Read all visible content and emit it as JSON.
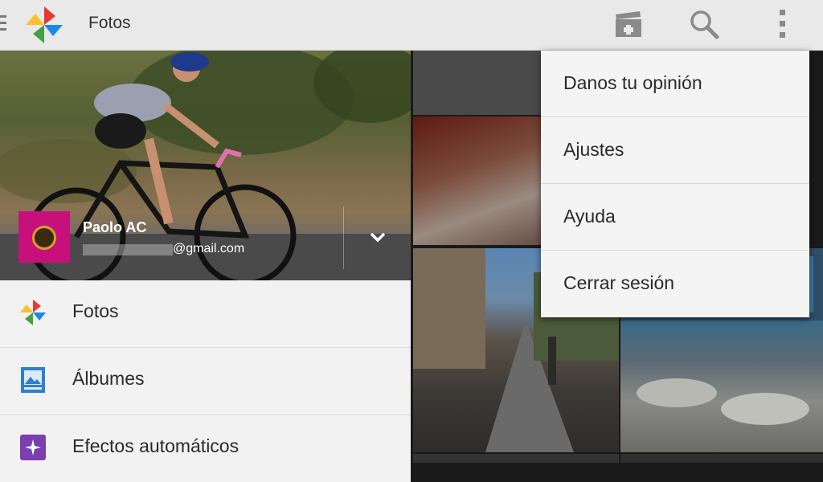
{
  "app": {
    "title": "Fotos"
  },
  "toolbar": {
    "icons": [
      "menu-icon",
      "photos-logo-icon",
      "create-movie-icon",
      "search-icon",
      "more-options-icon"
    ]
  },
  "account": {
    "name": "Paolo AC",
    "email_visible": "@gmail.com"
  },
  "nav": {
    "items": [
      {
        "label": "Fotos",
        "icon": "pinwheel-icon"
      },
      {
        "label": "Álbumes",
        "icon": "album-icon"
      },
      {
        "label": "Efectos automáticos",
        "icon": "sparkle-icon"
      }
    ]
  },
  "menu": {
    "items": [
      {
        "label": "Danos tu opinión"
      },
      {
        "label": "Ajustes"
      },
      {
        "label": "Ayuda"
      },
      {
        "label": "Cerrar sesión"
      }
    ]
  },
  "colors": {
    "toolbar_bg": "#e9e9e9",
    "avatar_bg": "#c8107c",
    "album_icon": "#2f7fd1",
    "effects_icon": "#7b3fb0"
  }
}
